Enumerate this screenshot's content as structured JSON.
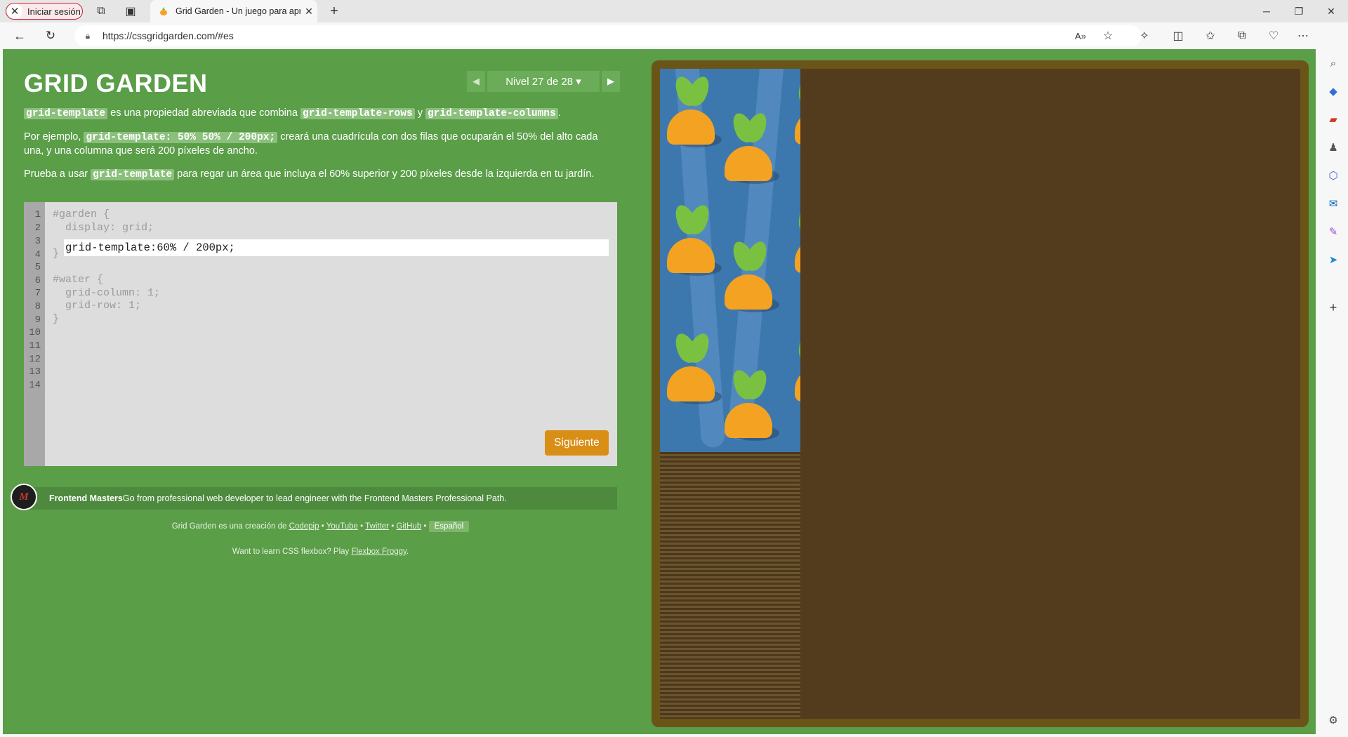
{
  "browser": {
    "profile_label": "Iniciar sesión",
    "tab_title": "Grid Garden - Un juego para apr",
    "url": "https://cssgridgarden.com/#es"
  },
  "game": {
    "logo": "GRID GARDEN",
    "level_label": "Nivel 27 de 28 ▾",
    "instructions": {
      "p1_tag1": "grid-template",
      "p1_text1": " es una propiedad abreviada que combina ",
      "p1_tag2": "grid-template-rows",
      "p1_text2": " y ",
      "p1_tag3": "grid-template-columns",
      "p1_text3": ".",
      "p2_text1": "Por ejemplo, ",
      "p2_tag1": "grid-template: 50% 50% / 200px;",
      "p2_text2": " creará una cuadrícula con dos filas que ocuparán el 50% del alto cada",
      "p2_line2": "una, y una columna que será 200 píxeles de ancho.",
      "p3_text1": "Prueba a usar ",
      "p3_tag1": "grid-template",
      "p3_text2": " para regar un área que incluya el 60% superior y 200 píxeles desde la izquierda en tu jardín."
    },
    "editor": {
      "line_numbers": [
        "1",
        "2",
        "3",
        "4",
        "5",
        "6",
        "7",
        "8",
        "9",
        "10",
        "11",
        "12",
        "13",
        "14"
      ],
      "line1": "#garden {",
      "line2": "  display: grid;",
      "input_value": "grid-template:60% / 200px;",
      "line4": "}",
      "line6": "#water {",
      "line7": "  grid-column: 1;",
      "line8": "  grid-row: 1;",
      "line9": "}",
      "next_label": "Siguiente"
    },
    "promo": {
      "logo": "M",
      "brand": "Frontend Masters",
      "text": " Go from professional web developer to lead engineer with the Frontend Masters Professional Path."
    },
    "footer": {
      "credit_prefix": "Grid Garden es una creación de ",
      "codepip": "Codepip",
      "youtube": "YouTube",
      "twitter": "Twitter",
      "github": "GitHub",
      "sep": " • ",
      "language": "Español",
      "flexbox_prefix": "Want to learn CSS flexbox? Play ",
      "flexbox_link": "Flexbox Froggy",
      "flexbox_suffix": "."
    }
  },
  "colors": {
    "page_bg": "#5a9e48",
    "water": "#3c78ae",
    "soil": "#533c1d",
    "button": "#d98e16"
  }
}
